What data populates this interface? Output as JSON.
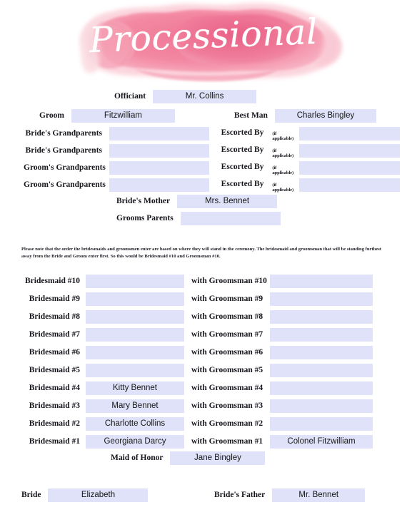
{
  "document": {
    "title": "Processional",
    "banner_colors": {
      "deep_pink": "#ea5f84",
      "mid_pink": "#f3849f",
      "light_pink": "#f8b8c6",
      "pale_pink": "#fad6dd"
    },
    "field_color": "#dfe2f8",
    "label_color": "#15151c"
  },
  "top_section": {
    "officiant": {
      "label": "Officiant",
      "value": "Mr. Collins"
    },
    "groom": {
      "label": "Groom",
      "value": "Fitzwilliam"
    },
    "best_man": {
      "label": "Best Man",
      "value": "Charles Bingley"
    },
    "escort_label": "Escorted  By",
    "escort_note": "(if applicable)",
    "grandparents": [
      {
        "label": "Bride's Grandparents",
        "value": "",
        "escort_value": ""
      },
      {
        "label": "Bride's Grandparents",
        "value": "",
        "escort_value": ""
      },
      {
        "label": "Groom's Grandparents",
        "value": "",
        "escort_value": ""
      },
      {
        "label": "Groom's Grandparents",
        "value": "",
        "escort_value": ""
      }
    ],
    "brides_mother": {
      "label": "Bride's Mother",
      "value": "Mrs. Bennet"
    },
    "grooms_parents": {
      "label": "Grooms Parents",
      "value": ""
    }
  },
  "note": "Please note that the order the bridesmaids and groomsmen enter are based on where they will stand in the ceremony. The bridesmaid and groomsman that will be standing furthest away from the Bride and Groom enter first. So this would be Bridesmaid #10 and Groomsman #10.",
  "wedding_party": [
    {
      "bridesmaid_label": "Bridesmaid #10",
      "bridesmaid_value": "",
      "groomsman_label": "with Groomsman #10",
      "groomsman_value": ""
    },
    {
      "bridesmaid_label": "Bridesmaid #9",
      "bridesmaid_value": "",
      "groomsman_label": "with Groomsman #9",
      "groomsman_value": ""
    },
    {
      "bridesmaid_label": "Bridesmaid #8",
      "bridesmaid_value": "",
      "groomsman_label": "with Groomsman #8",
      "groomsman_value": ""
    },
    {
      "bridesmaid_label": "Bridesmaid #7",
      "bridesmaid_value": "",
      "groomsman_label": "with Groomsman #7",
      "groomsman_value": ""
    },
    {
      "bridesmaid_label": "Bridesmaid #6",
      "bridesmaid_value": "",
      "groomsman_label": "with Groomsman #6",
      "groomsman_value": ""
    },
    {
      "bridesmaid_label": "Bridesmaid  #5",
      "bridesmaid_value": "",
      "groomsman_label": "with Groomsman #5",
      "groomsman_value": ""
    },
    {
      "bridesmaid_label": "Bridesmaid #4",
      "bridesmaid_value": "Kitty Bennet",
      "groomsman_label": "with Groomsman #4",
      "groomsman_value": ""
    },
    {
      "bridesmaid_label": "Bridesmaid #3",
      "bridesmaid_value": "Mary Bennet",
      "groomsman_label": "with Groomsman #3",
      "groomsman_value": ""
    },
    {
      "bridesmaid_label": "Bridesmaid #2",
      "bridesmaid_value": "Charlotte Collins",
      "groomsman_label": "with Groomsman #2",
      "groomsman_value": ""
    },
    {
      "bridesmaid_label": "Bridesmaid #1",
      "bridesmaid_value": "Georgiana Darcy",
      "groomsman_label": "with Groomsman #1",
      "groomsman_value": "Colonel Fitzwilliam"
    }
  ],
  "bottom_section": {
    "maid_of_honor": {
      "label": "Maid of Honor",
      "value": "Jane Bingley"
    },
    "bride": {
      "label": "Bride",
      "value": "Elizabeth"
    },
    "brides_father": {
      "label": "Bride's Father",
      "value": "Mr. Bennet"
    }
  }
}
